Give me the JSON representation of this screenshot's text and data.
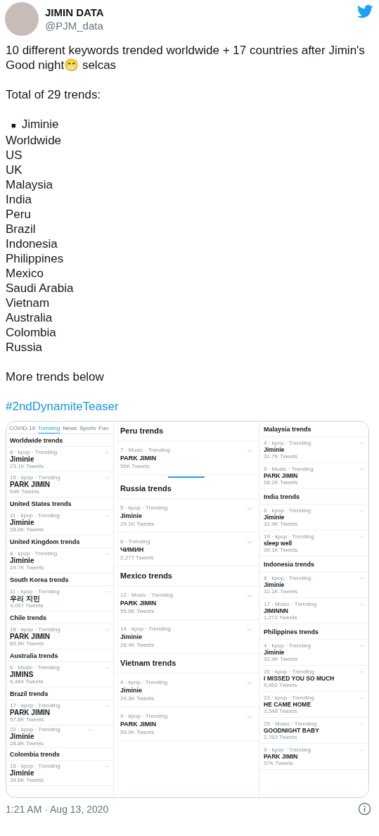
{
  "author": {
    "name": "JIMIN DATA",
    "handle": "@PJM_data"
  },
  "body": {
    "intro": "10 different keywords trended worldwide + 17 countries after Jimin's Good night😁 selcas",
    "total": "Total of 29 trends:",
    "keyword": {
      "bullet": "■",
      "text": "Jiminie"
    },
    "locations": [
      "Worldwide",
      "US",
      "UK",
      "Malaysia",
      "India",
      "Peru",
      "Brazil",
      "Indonesia",
      "Philippines",
      "Mexico",
      "Saudi Arabia",
      "Vietnam",
      "Australia",
      "Colombia",
      "Russia"
    ],
    "more": "More trends below",
    "hashtag": "#2ndDynamiteTeaser"
  },
  "image": {
    "columns": [
      {
        "tabs": [
          {
            "label": "COVID-19",
            "selected": false
          },
          {
            "label": "Trending",
            "selected": true
          },
          {
            "label": "News",
            "selected": false
          },
          {
            "label": "Sports",
            "selected": false
          },
          {
            "label": "Fun",
            "selected": false
          }
        ],
        "sections": [
          {
            "title": "Worldwide trends",
            "trends": [
              {
                "kind": "trend",
                "meta": "8 · kpop · Trending",
                "name": "Jiminie",
                "count": "23.1K Tweets"
              },
              {
                "kind": "trend",
                "meta": "15 · kpop · Trending",
                "name": "PARK JIMIN",
                "count": "54K Tweets"
              }
            ]
          },
          {
            "title": "United States trends",
            "trends": [
              {
                "kind": "trend",
                "meta": "11 · kpop · Trending",
                "name": "Jiminie",
                "count": "28.8K Tweets"
              }
            ]
          },
          {
            "title": "United Kingdom trends",
            "trends": [
              {
                "kind": "trend",
                "meta": "8 · kpop · Trending",
                "name": "Jiminie",
                "count": "29.7K Tweets"
              }
            ]
          },
          {
            "title": "South Korea trends",
            "trends": [
              {
                "kind": "trend",
                "meta": "11 · kpop · Trending",
                "name": "우리 지민",
                "count": "4,097 Tweets"
              }
            ]
          },
          {
            "title": "Chile trends",
            "trends": [
              {
                "kind": "trend",
                "meta": "18 · kpop · Trending",
                "name": "PARK JIMIN",
                "count": "60.5K Tweets"
              }
            ]
          },
          {
            "title": "Australia trends",
            "trends": [
              {
                "kind": "trend",
                "meta": "6 · Music · Trending",
                "name": "JIMINS",
                "count": "6,484 Tweets"
              }
            ]
          },
          {
            "title": "Brazil trends",
            "trends": [
              {
                "kind": "trend",
                "meta": "17 · kpop · Trending",
                "name": "PARK JIMIN",
                "count": "57.8K Tweets"
              },
              {
                "kind": "mini",
                "meta": "22 · kpop · Trending",
                "name": "Jiminie",
                "count": "28.8K Tweets"
              }
            ]
          },
          {
            "title": "Colombia trends",
            "trends": [
              {
                "kind": "trend",
                "meta": "15 · kpop · Trending",
                "name": "Jiminie",
                "count": "34.6K Tweets"
              }
            ]
          }
        ]
      },
      {
        "sections": [
          {
            "title": "Peru trends",
            "loading": true,
            "trends": [
              {
                "kind": "trend",
                "meta": "7 · Music · Trending",
                "name": "PARK JIMIN",
                "count": "56K Tweets"
              }
            ]
          },
          {
            "title": "Russia trends",
            "trends": [
              {
                "kind": "trend",
                "meta": "5 · kpop · Trending",
                "name": "Jiminie",
                "count": "29.1K Tweets"
              },
              {
                "kind": "trend",
                "meta": "6 · Trending",
                "name": "ЧИМИН",
                "count": "2,277 Tweets"
              }
            ]
          },
          {
            "title": "Mexico trends",
            "trends": [
              {
                "kind": "trend",
                "meta": "12 · Music · Trending",
                "name": "PARK JIMIN",
                "count": "55.5K Tweets"
              },
              {
                "kind": "trend",
                "meta": "14 · kpop · Trending",
                "name": "Jiminie",
                "count": "28.4K Tweets"
              }
            ]
          },
          {
            "title": "Vietnam trends",
            "trends": [
              {
                "kind": "trend",
                "meta": "4 · kpop · Trending",
                "name": "Jiminie",
                "count": "29.3K Tweets"
              },
              {
                "kind": "trend",
                "meta": "9 · kpop · Trending",
                "name": "PARK JIMIN",
                "count": "59.9K Tweets"
              }
            ]
          }
        ]
      },
      {
        "sections": [
          {
            "title": "Malaysia trends",
            "trends": [
              {
                "kind": "trend",
                "meta": "4 · kpop · Trending",
                "name": "Jiminie",
                "count": "31.7K Tweets"
              },
              {
                "kind": "trend",
                "meta": "5 · Music · Trending",
                "name": "PARK JIMIN",
                "count": "58.2K Tweets"
              }
            ]
          },
          {
            "title": "India trends",
            "trends": [
              {
                "kind": "trend",
                "meta": "6 · kpop · Trending",
                "name": "Jiminie",
                "count": "31.9K Tweets"
              },
              {
                "kind": "trend",
                "meta": "19 · kpop · Trending",
                "name": "sleep well",
                "count": "39.1K Tweets"
              }
            ]
          },
          {
            "title": "Indonesia trends",
            "trends": [
              {
                "kind": "trend",
                "meta": "8 · kpop · Trending",
                "name": "Jiminie",
                "count": "32.1K Tweets"
              },
              {
                "kind": "trend",
                "meta": "17 · Music · Trending",
                "name": "JIMINNN",
                "count": "1,272 Tweets"
              }
            ]
          },
          {
            "title": "Philippines trends",
            "trends": [
              {
                "kind": "trend",
                "meta": "4 · kpop · Trending",
                "name": "Jiminie",
                "count": "31.9K Tweets"
              },
              {
                "kind": "trend",
                "meta": "20 · kpop · Trending",
                "name": "I MISSED YOU SO MUCH",
                "count": "5,652 Tweets"
              },
              {
                "kind": "trend",
                "meta": "23 · kpop · Trending",
                "name": "HE CAME HOME",
                "count": "3,548 Tweets"
              },
              {
                "kind": "trend",
                "meta": "25 · Music · Trending",
                "name": "GOODNIGHT BABY",
                "count": "2,763 Tweets"
              },
              {
                "kind": "trend",
                "meta": "9 · kpop · Trending",
                "name": "PARK JIMIN",
                "count": "57K Tweets"
              }
            ]
          }
        ]
      }
    ]
  },
  "timestamp": "1:21 AM · Aug 13, 2020"
}
